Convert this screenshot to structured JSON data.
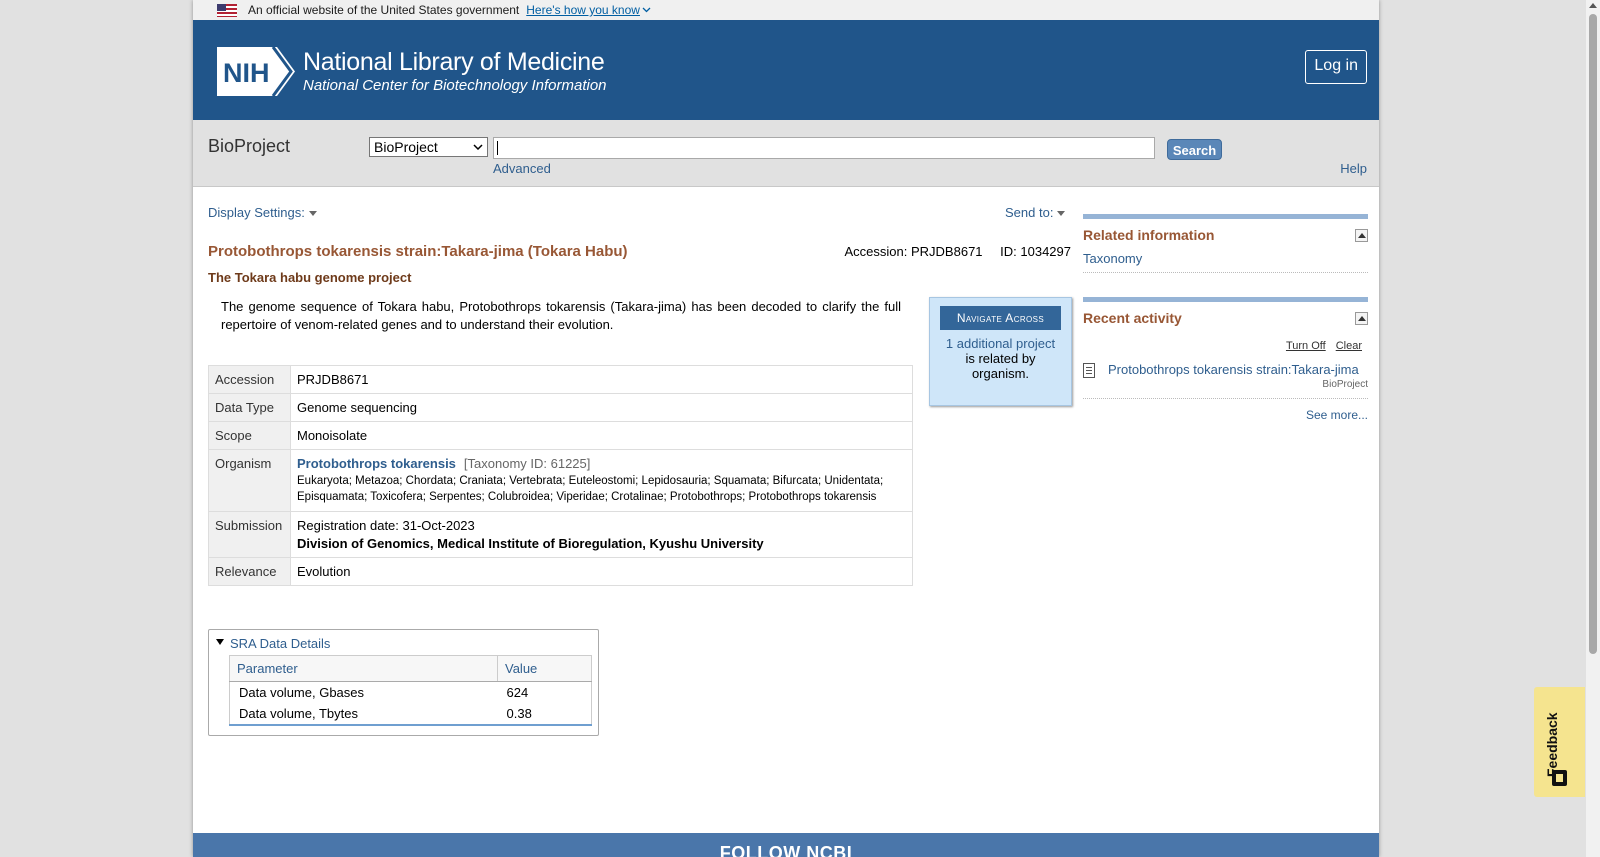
{
  "gov_banner": {
    "text": "An official website of the United States government",
    "how_link": "Here's how you know"
  },
  "header": {
    "logo_text": "NIH",
    "title": "National Library of Medicine",
    "subtitle": "National Center for Biotechnology Information",
    "login_label": "Log in"
  },
  "search": {
    "db_title": "BioProject",
    "db_selected": "BioProject",
    "query_value": "",
    "button_label": "Search",
    "advanced_label": "Advanced",
    "help_label": "Help"
  },
  "toolbar": {
    "display_settings": "Display Settings:",
    "send_to": "Send to:"
  },
  "record": {
    "title": "Protobothrops tokarensis strain:Takara-jima (Tokara Habu)",
    "accession_line": "Accession: PRJDB8671",
    "id_line": "ID: 1034297",
    "subtitle": "The Tokara habu genome project",
    "description": "The genome sequence of Tokara habu, Protobothrops tokarensis (Takara-jima) has been decoded to clarify the full repertoire of venom-related genes and to understand their evolution."
  },
  "navigate": {
    "title": "Navigate Across",
    "link": "1 additional project",
    "text": "is related by organism."
  },
  "details": {
    "accession_label": "Accession",
    "accession_value": "PRJDB8671",
    "datatype_label": "Data Type",
    "datatype_value": "Genome sequencing",
    "scope_label": "Scope",
    "scope_value": "Monoisolate",
    "organism_label": "Organism",
    "organism_name": "Protobothrops tokarensis",
    "taxonomy_id": "[Taxonomy ID: 61225]",
    "lineage": "Eukaryota; Metazoa; Chordata; Craniata; Vertebrata; Euteleostomi; Lepidosauria; Squamata; Bifurcata; Unidentata; Episquamata; Toxicofera; Serpentes; Colubroidea; Viperidae; Crotalinae; Protobothrops; Protobothrops tokarensis",
    "submission_label": "Submission",
    "registration": "Registration date: 31-Oct-2023",
    "institution": "Division of Genomics, Medical Institute of Bioregulation, Kyushu University",
    "relevance_label": "Relevance",
    "relevance_value": "Evolution"
  },
  "sra": {
    "header": "SRA Data Details",
    "col_param": "Parameter",
    "col_value": "Value",
    "rows": [
      {
        "param": "Data volume, Gbases",
        "value": "624"
      },
      {
        "param": "Data volume, Tbytes",
        "value": "0.38"
      }
    ]
  },
  "sidebar": {
    "related_title": "Related information",
    "related_link": "Taxonomy",
    "recent_title": "Recent activity",
    "turn_off": "Turn Off",
    "clear": "Clear",
    "recent_item": "Protobothrops tokarensis strain:Takara-jima",
    "recent_item_source": "BioProject",
    "see_more": "See more..."
  },
  "footer": {
    "follow": "FOLLOW NCBI"
  },
  "feedback": {
    "label": "Feedback"
  }
}
